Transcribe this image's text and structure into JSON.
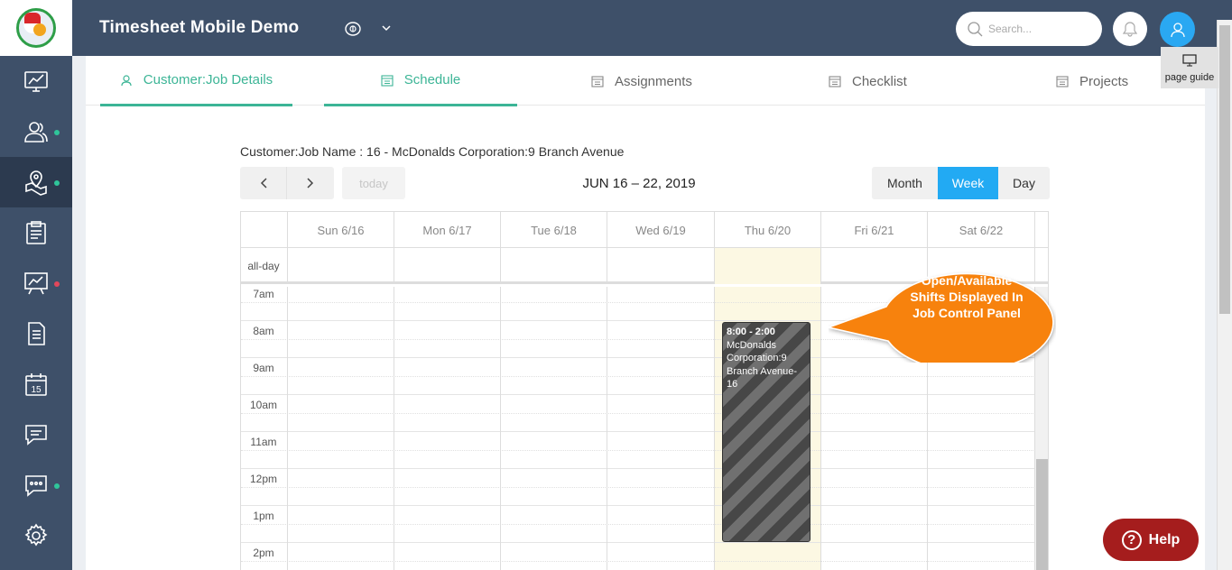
{
  "app": {
    "title": "Timesheet Mobile Demo"
  },
  "header": {
    "search_placeholder": "Search..."
  },
  "sidebar": {
    "items": [
      {
        "name": "dashboard",
        "icon": "monitor-chart-icon",
        "dot": null
      },
      {
        "name": "employees",
        "icon": "users-icon",
        "dot": "#2fc59a"
      },
      {
        "name": "job-map",
        "icon": "map-pin-icon",
        "dot": "#2fc59a",
        "active": true
      },
      {
        "name": "clipboard",
        "icon": "clipboard-icon",
        "dot": null
      },
      {
        "name": "reports",
        "icon": "presentation-icon",
        "dot": "#e2475b"
      },
      {
        "name": "documents",
        "icon": "document-icon",
        "dot": null
      },
      {
        "name": "calendar",
        "icon": "calendar-icon",
        "dot": null
      },
      {
        "name": "messages",
        "icon": "chat-icon",
        "dot": null
      },
      {
        "name": "chat",
        "icon": "chat-dots-icon",
        "dot": "#2fc59a"
      },
      {
        "name": "settings",
        "icon": "gear-icon",
        "dot": null
      }
    ],
    "calendar_icon_text": "15"
  },
  "tabs": [
    {
      "label": "Customer:Job Details",
      "active": true
    },
    {
      "label": "Schedule",
      "active": true
    },
    {
      "label": "Assignments",
      "active": false
    },
    {
      "label": "Checklist",
      "active": false
    },
    {
      "label": "Projects",
      "active": false
    }
  ],
  "page_guide": {
    "label": "page guide"
  },
  "job": {
    "name": "Customer:Job Name : 16 - McDonalds Corporation:9 Branch Avenue"
  },
  "calendar": {
    "today_label": "today",
    "range_title": "JUN 16 – 22, 2019",
    "views": [
      {
        "label": "Month",
        "active": false
      },
      {
        "label": "Week",
        "active": true
      },
      {
        "label": "Day",
        "active": false
      }
    ],
    "days": [
      "Sun 6/16",
      "Mon 6/17",
      "Tue 6/18",
      "Wed 6/19",
      "Thu 6/20",
      "Fri 6/21",
      "Sat 6/22"
    ],
    "today_index": 4,
    "allday_label": "all-day",
    "time_slots": [
      "7am",
      "8am",
      "9am",
      "10am",
      "11am",
      "12pm",
      "1pm",
      "2pm"
    ],
    "event": {
      "time": "8:00 - 2:00",
      "title": "McDonalds Corporation:9 Branch Avenue-16"
    }
  },
  "callout": {
    "text": "Open/Available Shifts Displayed In Job Control Panel",
    "color": "#f7820f"
  },
  "help": {
    "label": "Help"
  },
  "colors": {
    "sidebar": "#3e5069",
    "accent": "#3cb596",
    "primary": "#22aaf3",
    "help": "#a51d1d"
  }
}
